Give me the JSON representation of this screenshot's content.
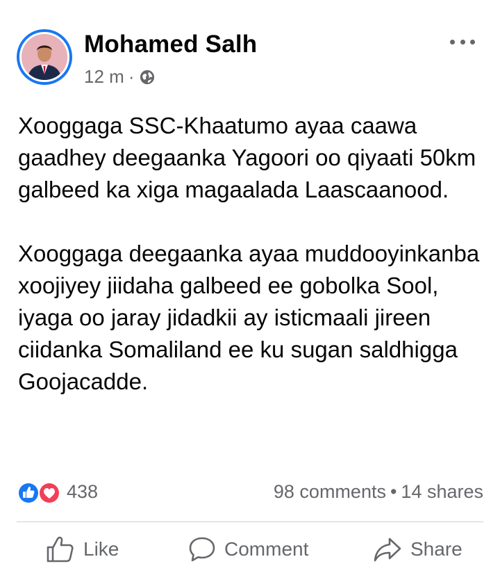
{
  "post": {
    "author": "Mohamed Salh",
    "time": "12 m",
    "paragraphs": [
      "Xooggaga SSC-Khaatumo ayaa caawa gaadhey deegaanka Yagoori oo qiyaati 50km galbeed ka xiga magaalada Laascaanood.",
      "Xooggaga deegaanka ayaa muddooyinkanba xoojiyey jiidaha galbeed ee gobolka Sool, iyaga oo jaray jidadkii ay isticmaali jireen ciidanka Somaliland ee ku sugan saldhigga Goojacadde."
    ]
  },
  "stats": {
    "reactions_count": "438",
    "comments": "98 comments",
    "separator": "•",
    "shares": "14 shares"
  },
  "actions": {
    "like": "Like",
    "comment": "Comment",
    "share": "Share"
  },
  "icons": {
    "audience": "globe-icon",
    "more": "more-options-icon",
    "reactions": [
      "like-reaction-icon",
      "love-reaction-icon"
    ]
  },
  "colors": {
    "like_blue": "#1877f2",
    "love_red": "#f33e58",
    "secondary_text": "#65676b"
  }
}
